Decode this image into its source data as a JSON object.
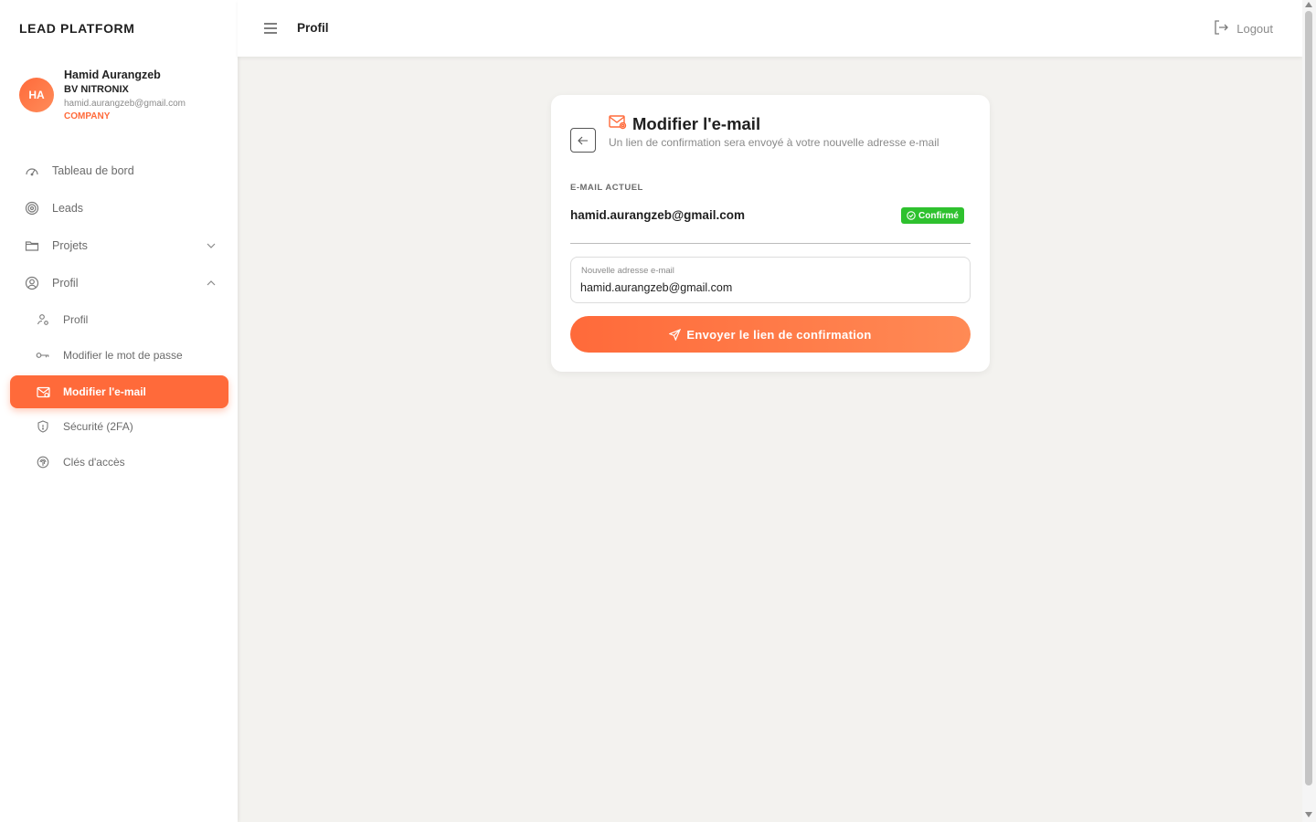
{
  "app": {
    "brand": "LEAD PLATFORM"
  },
  "user": {
    "initials": "HA",
    "name": "Hamid Aurangzeb",
    "company": "BV NITRONIX",
    "email": "hamid.aurangzeb@gmail.com",
    "role": "COMPANY"
  },
  "nav": {
    "dashboard": "Tableau de bord",
    "leads": "Leads",
    "projects": "Projets",
    "profile": "Profil",
    "sub": {
      "profile": "Profil",
      "password": "Modifier le mot de passe",
      "email": "Modifier l'e-mail",
      "security": "Sécurité (2FA)",
      "keys": "Clés d'accès"
    }
  },
  "topbar": {
    "title": "Profil",
    "logout": "Logout"
  },
  "card": {
    "title": "Modifier l'e-mail",
    "description": "Un lien de confirmation sera envoyé à votre nouvelle adresse e-mail",
    "current_label": "E-MAIL ACTUEL",
    "current_email": "hamid.aurangzeb@gmail.com",
    "badge": "Confirmé",
    "field_label": "Nouvelle adresse e-mail",
    "field_value": "hamid.aurangzeb@gmail.com",
    "submit": "Envoyer le lien de confirmation"
  },
  "colors": {
    "accent": "#ff6a3a",
    "success": "#2ec12e"
  }
}
